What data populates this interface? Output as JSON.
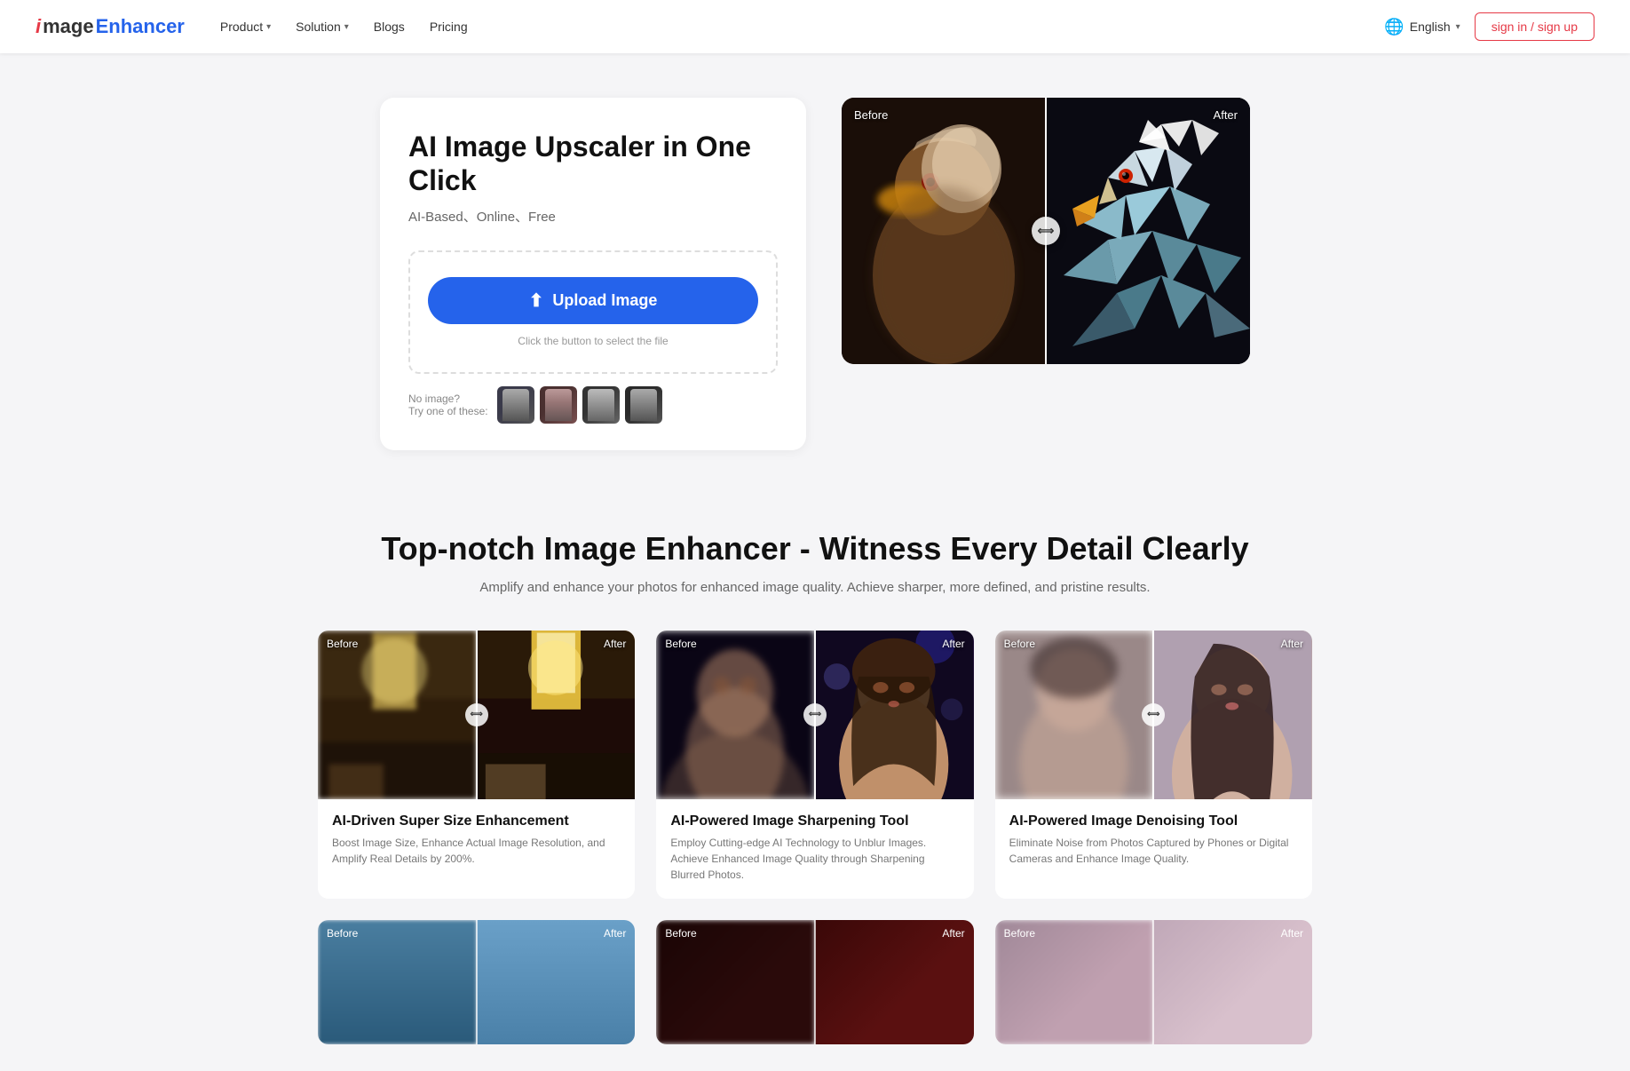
{
  "navbar": {
    "logo_i": "i",
    "logo_image": "mage",
    "logo_enhancer": "Enhancer",
    "nav_links": [
      {
        "label": "Product",
        "has_dropdown": true
      },
      {
        "label": "Solution",
        "has_dropdown": true
      },
      {
        "label": "Blogs",
        "has_dropdown": false
      },
      {
        "label": "Pricing",
        "has_dropdown": false
      }
    ],
    "language": "English",
    "signin_label": "sign in / sign up"
  },
  "hero": {
    "title": "AI Image Upscaler in One Click",
    "subtitle": "AI-Based、Online、Free",
    "upload_button_label": "Upload Image",
    "upload_hint": "Click the button to select the file",
    "sample_text_line1": "No image?",
    "sample_text_line2": "Try one of these:",
    "before_label": "Before",
    "after_label": "After",
    "handle_icon": "⟺"
  },
  "features_section": {
    "title": "Top-notch Image Enhancer - Witness Every Detail Clearly",
    "subtitle": "Amplify and enhance your photos for enhanced image quality. Achieve sharper, more defined, and pristine results.",
    "cards": [
      {
        "before_label": "Before",
        "after_label": "After",
        "name": "AI-Driven Super Size Enhancement",
        "desc": "Boost Image Size, Enhance Actual Image Resolution, and Amplify Real Details by 200%.",
        "handle_icon": "⟺"
      },
      {
        "before_label": "Before",
        "after_label": "After",
        "name": "AI-Powered Image Sharpening Tool",
        "desc": "Employ Cutting-edge AI Technology to Unblur Images. Achieve Enhanced Image Quality through Sharpening Blurred Photos.",
        "handle_icon": "⟺"
      },
      {
        "before_label": "Before",
        "after_label": "After",
        "name": "AI-Powered Image Denoising Tool",
        "desc": "Eliminate Noise from Photos Captured by Phones or Digital Cameras and Enhance Image Quality.",
        "handle_icon": "⟺"
      }
    ],
    "bottom_cards": [
      {
        "before_label": "Before",
        "after_label": "After"
      },
      {
        "before_label": "Before",
        "after_label": "After"
      },
      {
        "before_label": "Before",
        "after_label": "After"
      }
    ]
  }
}
